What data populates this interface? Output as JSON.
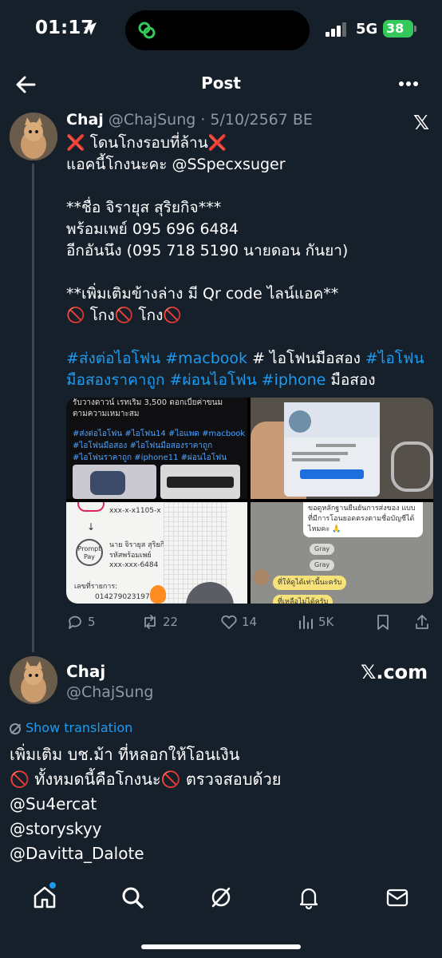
{
  "status_bar": {
    "time": "01:17",
    "network": "5G",
    "battery": "38"
  },
  "header": {
    "title": "Post"
  },
  "post": {
    "author_name": "Chaj",
    "author_handle": "@ChajSung",
    "date": "5/10/2567 BE",
    "body_lines": [
      "❌ โดนโกงรอบที่ล้าน❌",
      "แอคนี้โกงนะคะ @SSpecxsuger",
      "",
      "**ชื่อ จิรายุส สุริยกิจ***",
      "พร้อมเพย์ 095 696 6484",
      "อีกอันนึง (095 718 5190 นายดอน กันยา)",
      "",
      "**เพิ่มเติมข้างล่าง มี Qr code ไลน์แอค**",
      "🚫 โกง🚫 โกง🚫",
      ""
    ],
    "hashtags_line1": {
      "tag1": "#ส่งต่อไอโฟน",
      "tag2": "#macbook",
      "plain": " # ไอโฟนมือสอง ",
      "tag3": "#ไอโฟน"
    },
    "hashtags_line2": {
      "tag1": "มือสองราคาถูก",
      "tag2": "#ผ่อนไอโฟน",
      "tag3": "#iphone",
      "plain": " มือสอง"
    },
    "media": {
      "image1_text": [
        "รับวางดาวน์ เรทเริ่ม 3,500 ดอกเบี้ยค่าขนม",
        "ตามความเหมาะสม"
      ],
      "image1_tags": [
        "#ส่งต่อไอโฟน #ไอโฟน14 #ไอแพด #macbook",
        "#ไอโฟนมือสอง #ไอโฟนมือสองราคาถูก",
        "#ไอโฟนราคาถูก #iphone11 #ผ่อนไอโฟน"
      ],
      "image3_account": "xxx-x-x1105-x",
      "image3_name": "นาย จิรายุส สุริยกิจ",
      "image3_label": "รหัสพร้อมเพย์",
      "image3_pp_number": "xxx-xxx-6484",
      "image3_ref_label": "เลขที่รายการ:",
      "image3_ref": "014279023197",
      "image3_promptpay": "Prompt Pay",
      "image4_bubble": "ขอดูหลักฐานยืนยันการส่งของ แบบที่มีการโอนยอดตรงตามชื่อบัญชีได้ไหมคะ 🙏",
      "image4_chip": "Gray",
      "image4_reply1": "ที่ให้ดูได้เท่านี้นะครับ",
      "image4_reply2": "ที่เหลือไม่ได้ครับ"
    },
    "actions": {
      "replies": "5",
      "reposts": "22",
      "likes": "14",
      "views": "5K"
    }
  },
  "quoted_post": {
    "author_name": "Chaj",
    "author_handle": "@ChajSung",
    "source": "𝕏.com",
    "show_translation": "Show translation",
    "body_lines": [
      "เพิ่มเติม บช.ม้า ที่หลอกให้โอนเงิน",
      "🚫 ทั้งหมดนี้คือโกงนะ🚫 ตรวจสอบด้วย",
      "@Su4ercat",
      "@storyskyy",
      "@Davitta_Dalote"
    ]
  },
  "bottom_nav": [
    "home-icon",
    "search-icon",
    "grok-icon",
    "notifications-icon",
    "messages-icon"
  ],
  "colors": {
    "background": "#16202b",
    "accent": "#1d9bf0",
    "secondary_text": "#8b98a5",
    "battery": "#34c759"
  }
}
